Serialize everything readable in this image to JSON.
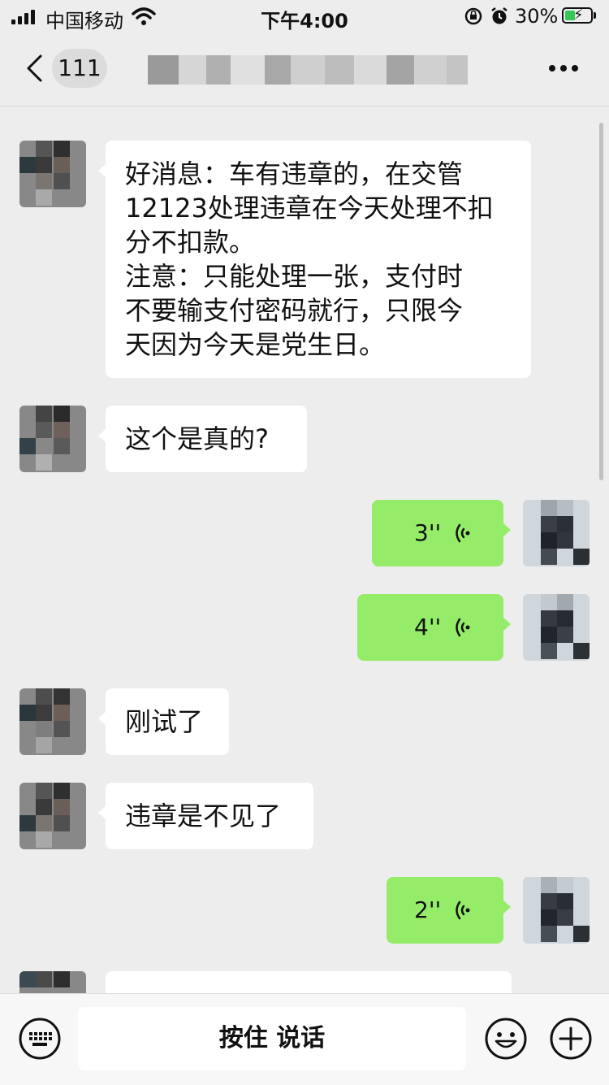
{
  "status_bar": {
    "carrier": "中国移动",
    "time": "下午4:00",
    "battery": "30%"
  },
  "nav": {
    "unread_count": "111"
  },
  "messages": [
    {
      "side": "left",
      "type": "text",
      "text": "好消息：车有违章的，在交管\n12123处理违章在今天处理不扣\n分不扣款。\n注意：只能处理一张，支付时\n不要输支付密码就行，只限今\n天因为今天是党生日。"
    },
    {
      "side": "left",
      "type": "text",
      "text": "这个是真的?"
    },
    {
      "side": "right",
      "type": "voice",
      "duration": "3''"
    },
    {
      "side": "right",
      "type": "voice",
      "duration": "4''"
    },
    {
      "side": "left",
      "type": "text",
      "text": "刚试了"
    },
    {
      "side": "left",
      "type": "text",
      "text": "违章是不见了"
    },
    {
      "side": "right",
      "type": "voice",
      "duration": "2''"
    }
  ],
  "input_bar": {
    "hold_to_talk": "按住 说话"
  },
  "icons": {
    "back": "chevron-left-icon",
    "more": "more-icon",
    "keyboard": "keyboard-icon",
    "emoji": "emoji-icon",
    "plus": "plus-icon",
    "voice": "voice-wave-icon"
  },
  "colors": {
    "background": "#ededed",
    "sent_bubble": "#95ec69",
    "received_bubble": "#ffffff",
    "battery_fill": "#34c759"
  }
}
